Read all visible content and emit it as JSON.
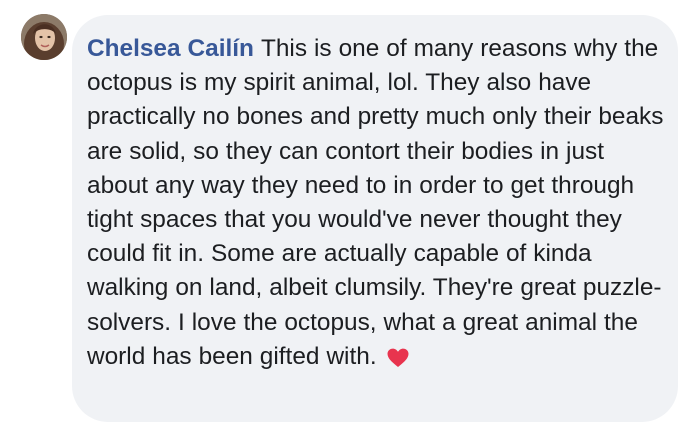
{
  "comment": {
    "author": "Chelsea Cailín",
    "text": "This is one of many reasons why the octopus is my spirit animal, lol. They also have practically no bones and pretty much only their beaks are solid, so they can contort their bodies in just about any way they need to in order to get through tight spaces that you would've never thought they could fit in. Some are actually capable of kinda walking on land, albeit clumsily. They're great puzzle-solvers. I love the octopus, what a great animal the world has been gifted with.",
    "emoji": "heart-icon"
  },
  "colors": {
    "author_name": "#385898",
    "comment_text": "#1c1e21",
    "bubble_background": "#f0f2f5",
    "heart": "#e8344e"
  }
}
